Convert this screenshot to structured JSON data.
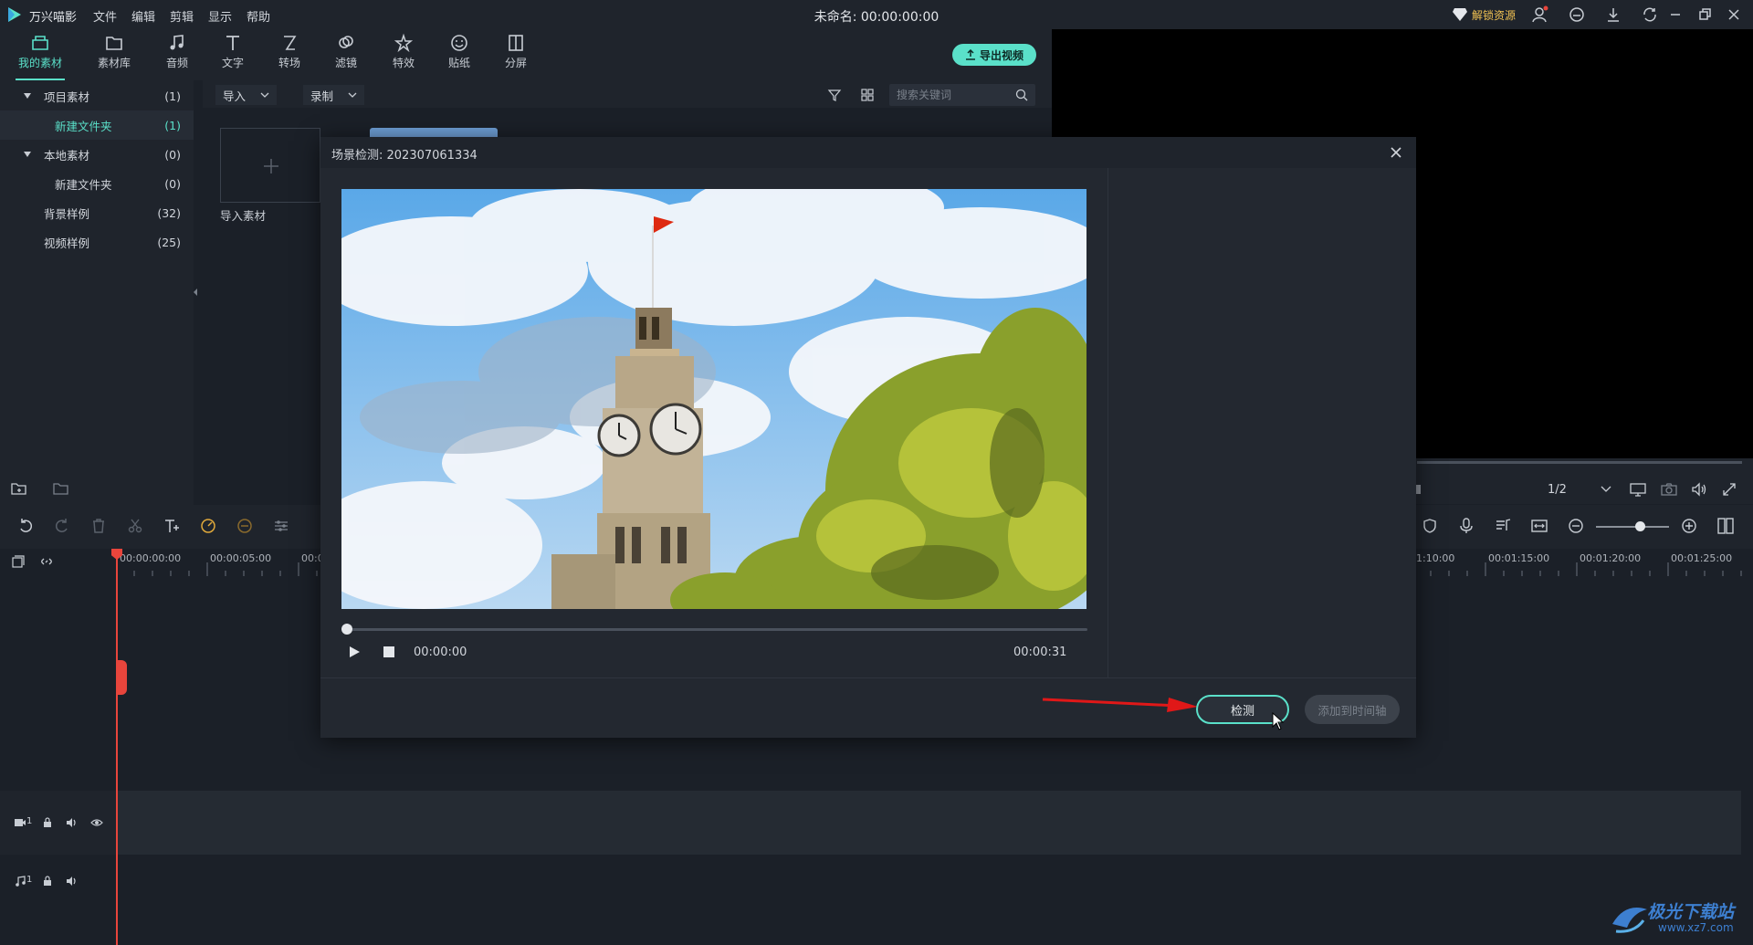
{
  "app": {
    "name": "万兴喵影",
    "window_title": "未命名: 00:00:00:00",
    "unlock_label": "解锁资源"
  },
  "menu": [
    "文件",
    "编辑",
    "剪辑",
    "显示",
    "帮助"
  ],
  "toolbar": {
    "tools": [
      {
        "label": "我的素材",
        "icon": "my-media-icon",
        "active": true
      },
      {
        "label": "素材库",
        "icon": "folder-icon"
      },
      {
        "label": "音频",
        "icon": "music-note-icon"
      },
      {
        "label": "文字",
        "icon": "text-icon"
      },
      {
        "label": "转场",
        "icon": "transition-icon"
      },
      {
        "label": "滤镜",
        "icon": "filter-icon"
      },
      {
        "label": "特效",
        "icon": "effects-icon"
      },
      {
        "label": "贴纸",
        "icon": "sticker-icon"
      },
      {
        "label": "分屏",
        "icon": "split-screen-icon"
      }
    ],
    "export_label": "导出视频"
  },
  "left_panel": {
    "items": [
      {
        "label": "项目素材",
        "count": "(1)",
        "expandable": true
      },
      {
        "label": "新建文件夹",
        "count": "(1)",
        "selected": true
      },
      {
        "label": "本地素材",
        "count": "(0)",
        "expandable": true
      },
      {
        "label": "新建文件夹",
        "count": "(0)"
      },
      {
        "label": "背景样例",
        "count": "(32)"
      },
      {
        "label": "视频样例",
        "count": "(25)"
      }
    ]
  },
  "media": {
    "import_dropdown": "导入",
    "record_dropdown": "录制",
    "search_placeholder": "搜索关键词",
    "import_tile_label": "导入素材"
  },
  "preview": {
    "page_indicator": "1/2"
  },
  "timeline": {
    "ticks_left": [
      "00:00:00:00",
      "00:00:05:00",
      "00:0"
    ],
    "ticks_right": [
      "1:10:00",
      "00:01:15:00",
      "00:01:20:00",
      "00:01:25:00"
    ],
    "video_track_label": "1",
    "audio_track_label": "1"
  },
  "modal": {
    "title": "场景检测: 202307061334",
    "time_current": "00:00:00",
    "time_total": "00:00:31",
    "detect_label": "检测",
    "add_to_timeline_label": "添加到时间轴"
  },
  "watermark": {
    "name": "极光下载站",
    "url": "www.xz7.com"
  },
  "colors": {
    "accent": "#5ae0c9",
    "playhead": "#e8453c",
    "background": "#1b2028"
  }
}
